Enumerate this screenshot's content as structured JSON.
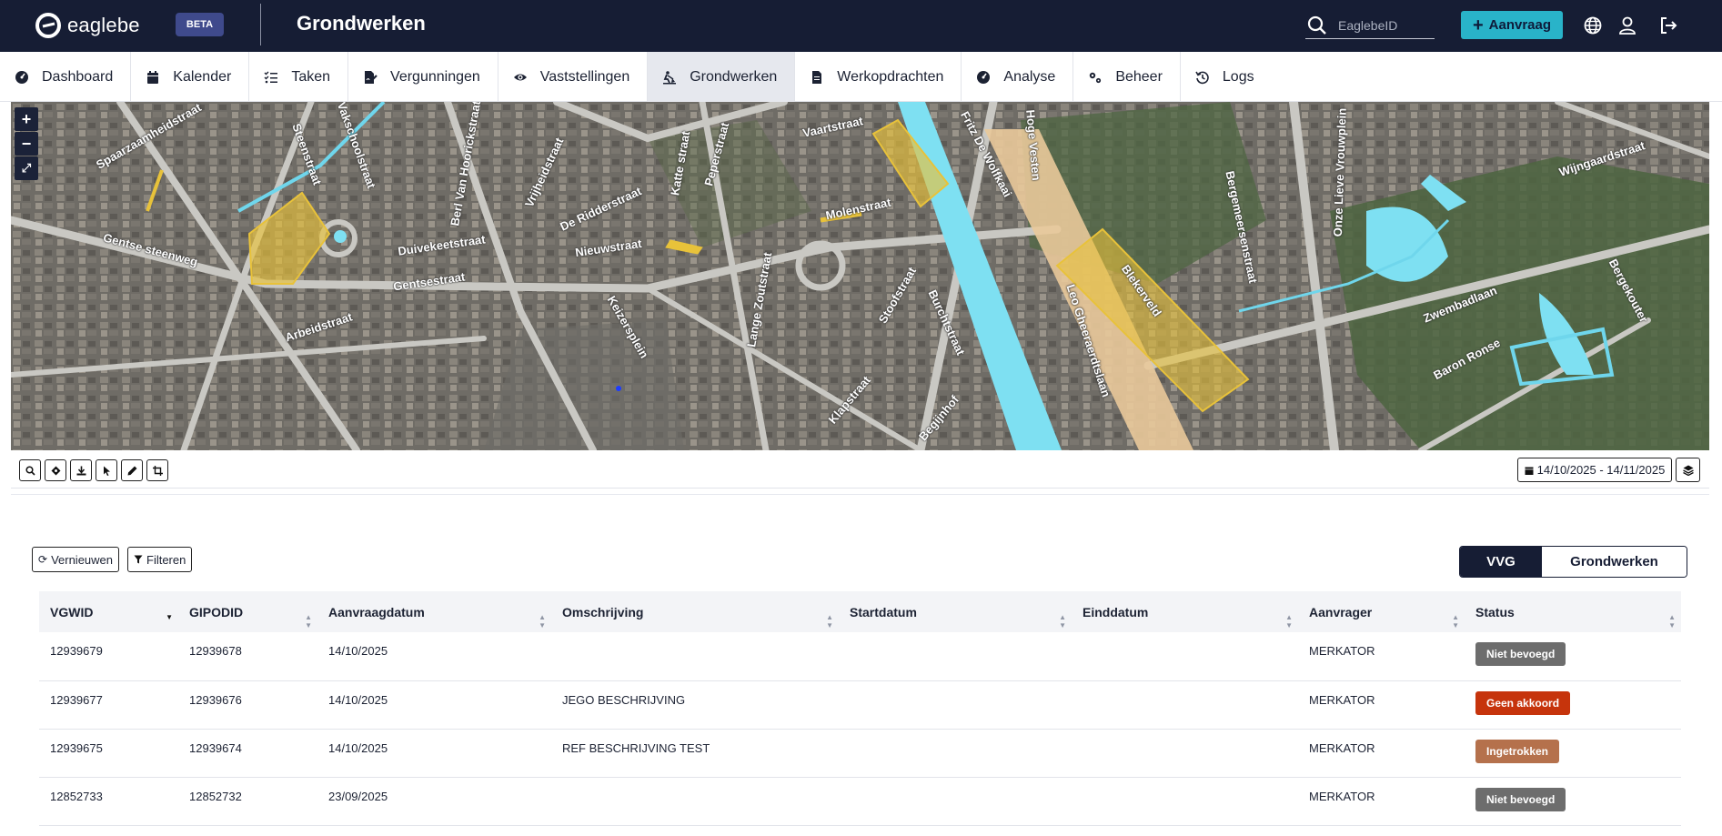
{
  "app": {
    "logo_text": "eaglebe",
    "beta_label": "BETA",
    "page_title": "Grondwerken",
    "search_placeholder": "EaglebeID",
    "aanvraag_label": "Aanvraag"
  },
  "nav": [
    {
      "label": "Dashboard",
      "icon": "gauge-icon"
    },
    {
      "label": "Kalender",
      "icon": "calendar-icon"
    },
    {
      "label": "Taken",
      "icon": "tasks-icon"
    },
    {
      "label": "Vergunningen",
      "icon": "file-signature-icon"
    },
    {
      "label": "Vaststellingen",
      "icon": "eye-icon"
    },
    {
      "label": "Grondwerken",
      "icon": "digging-icon",
      "active": true
    },
    {
      "label": "Werkopdrachten",
      "icon": "document-icon"
    },
    {
      "label": "Analyse",
      "icon": "gauge-icon"
    },
    {
      "label": "Beheer",
      "icon": "gears-icon"
    },
    {
      "label": "Logs",
      "icon": "history-icon"
    }
  ],
  "map": {
    "street_labels": [
      "Spaarzaamheidstraat",
      "Steenstraat",
      "Vakschoolstraat",
      "Berl Van Hoorickstraat",
      "Gentse steenweg",
      "Duivekeetstraat",
      "Gentsestraat",
      "Arbeidstraat",
      "Vrijheidstraat",
      "De Ridderstraat",
      "Nieuwstraat",
      "Keizersplein",
      "Lange Zoutstraat",
      "Molenstraat",
      "Vaartstraat",
      "Fritz De Wolfkaai",
      "Hoge Vesten",
      "Leo Gheeraerdtslaan",
      "Burchtstraat",
      "Stoofstraat",
      "Klapstraat",
      "Begijnhof",
      "Bergemeersenstraat",
      "Onze Lieve Vrouwplein",
      "Zwembadlaan",
      "Baron Ronse",
      "Wijngaardstraat",
      "Bergekouter",
      "Katte straat",
      "Peperstraat",
      "Blekerveld"
    ]
  },
  "toolbar": {
    "date_range": "14/10/2025 - 14/11/2025"
  },
  "actions": {
    "refresh_label": "Vernieuwen",
    "filter_label": "Filteren"
  },
  "view_toggle": {
    "option_a": "VVG",
    "option_b": "Grondwerken",
    "selected": "VVG"
  },
  "table": {
    "columns": [
      "VGWID",
      "GIPODID",
      "Aanvraagdatum",
      "Omschrijving",
      "Startdatum",
      "Einddatum",
      "Aanvrager",
      "Status"
    ],
    "rows": [
      {
        "vgwid": "12939679",
        "gipodid": "12939678",
        "aanvraagdatum": "14/10/2025",
        "omschrijving": "",
        "startdatum": "",
        "einddatum": "",
        "aanvrager": "MERKATOR",
        "status": "Niet bevoegd",
        "status_color": "#6d6d6d"
      },
      {
        "vgwid": "12939677",
        "gipodid": "12939676",
        "aanvraagdatum": "14/10/2025",
        "omschrijving": "JEGO BESCHRIJVING",
        "startdatum": "",
        "einddatum": "",
        "aanvrager": "MERKATOR",
        "status": "Geen akkoord",
        "status_color": "#c6340c"
      },
      {
        "vgwid": "12939675",
        "gipodid": "12939674",
        "aanvraagdatum": "14/10/2025",
        "omschrijving": "REF BESCHRIJVING TEST",
        "startdatum": "",
        "einddatum": "",
        "aanvrager": "MERKATOR",
        "status": "Ingetrokken",
        "status_color": "#b5714c"
      },
      {
        "vgwid": "12852733",
        "gipodid": "12852732",
        "aanvraagdatum": "23/09/2025",
        "omschrijving": "",
        "startdatum": "",
        "einddatum": "",
        "aanvrager": "MERKATOR",
        "status": "Niet bevoegd",
        "status_color": "#6d6d6d"
      }
    ]
  },
  "colors": {
    "topbar": "#161d34",
    "accent": "#29b3c9",
    "map_highlight": "#e8c23a"
  }
}
